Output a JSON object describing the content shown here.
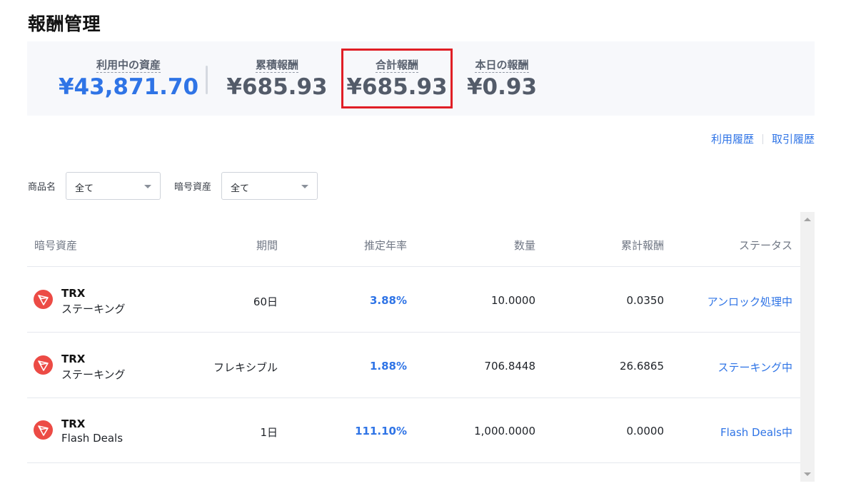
{
  "page": {
    "title": "報酬管理"
  },
  "summary": {
    "assets_in_use": {
      "label": "利用中の資産",
      "value": "¥43,871.70"
    },
    "cumulative_reward": {
      "label": "累積報酬",
      "value": "¥685.93"
    },
    "total_reward": {
      "label": "合計報酬",
      "value": "¥685.93"
    },
    "today_reward": {
      "label": "本日の報酬",
      "value": "¥0.93"
    }
  },
  "links": {
    "usage_history": "利用履歴",
    "trade_history": "取引履歴"
  },
  "filters": {
    "product": {
      "label": "商品名",
      "value": "全て"
    },
    "crypto": {
      "label": "暗号資産",
      "value": "全て"
    }
  },
  "table": {
    "headers": {
      "asset": "暗号資産",
      "period": "期間",
      "apr": "推定年率",
      "quantity": "数量",
      "cumulative_reward": "累計報酬",
      "status": "ステータス"
    },
    "rows": [
      {
        "coin": "TRX",
        "type": "ステーキング",
        "period": "60日",
        "apr": "3.88%",
        "quantity": "10.0000",
        "reward": "0.0350",
        "status": "アンロック処理中",
        "icon": "tron-icon"
      },
      {
        "coin": "TRX",
        "type": "ステーキング",
        "period": "フレキシブル",
        "apr": "1.88%",
        "quantity": "706.8448",
        "reward": "26.6865",
        "status": "ステーキング中",
        "icon": "tron-icon"
      },
      {
        "coin": "TRX",
        "type": "Flash Deals",
        "period": "1日",
        "apr": "111.10%",
        "quantity": "1,000.0000",
        "reward": "0.0000",
        "status": "Flash Deals中",
        "icon": "tron-icon"
      }
    ]
  },
  "colors": {
    "accent": "#2f74e6",
    "highlight": "#e01e25",
    "coin_icon": "#ec4b45"
  }
}
